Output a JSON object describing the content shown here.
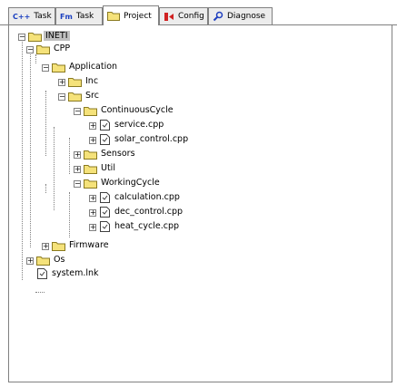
{
  "tabs": [
    {
      "label": "Task",
      "icon": "cpp-task-icon",
      "glyph": "C++",
      "active": false
    },
    {
      "label": "Task",
      "icon": "fm-task-icon",
      "glyph": "Fm",
      "active": false
    },
    {
      "label": "Project",
      "icon": "folder-icon",
      "glyph": "",
      "active": true
    },
    {
      "label": "Config",
      "icon": "config-icon",
      "glyph": "",
      "active": false
    },
    {
      "label": "Diagnose",
      "icon": "diagnose-icon",
      "glyph": "",
      "active": false
    }
  ],
  "tree": {
    "root": "INETI",
    "cpp": "CPP",
    "application": "Application",
    "inc": "Inc",
    "src": "Src",
    "continuous_cycle": "ContinuousCycle",
    "service_cpp": "service.cpp",
    "solar_control_cpp": "solar_control.cpp",
    "sensors": "Sensors",
    "util": "Util",
    "working_cycle": "WorkingCycle",
    "calculation_cpp": "calculation.cpp",
    "dec_control_cpp": "dec_control.cpp",
    "heat_cycle_cpp": "heat_cycle.cpp",
    "firmware": "Firmware",
    "os": "Os",
    "system_lnk": "system.lnk",
    "expand_symbol": "+",
    "collapse_symbol": "−"
  },
  "colors": {
    "folder_fill": "#f5e27a",
    "folder_stroke": "#8a7a20",
    "selection": "#c0c0c0",
    "cpp_icon": "#1a3fc0",
    "fm_icon": "#1a3fc0",
    "config_icon": "#d02020",
    "diagnose_icon": "#2040c0"
  }
}
